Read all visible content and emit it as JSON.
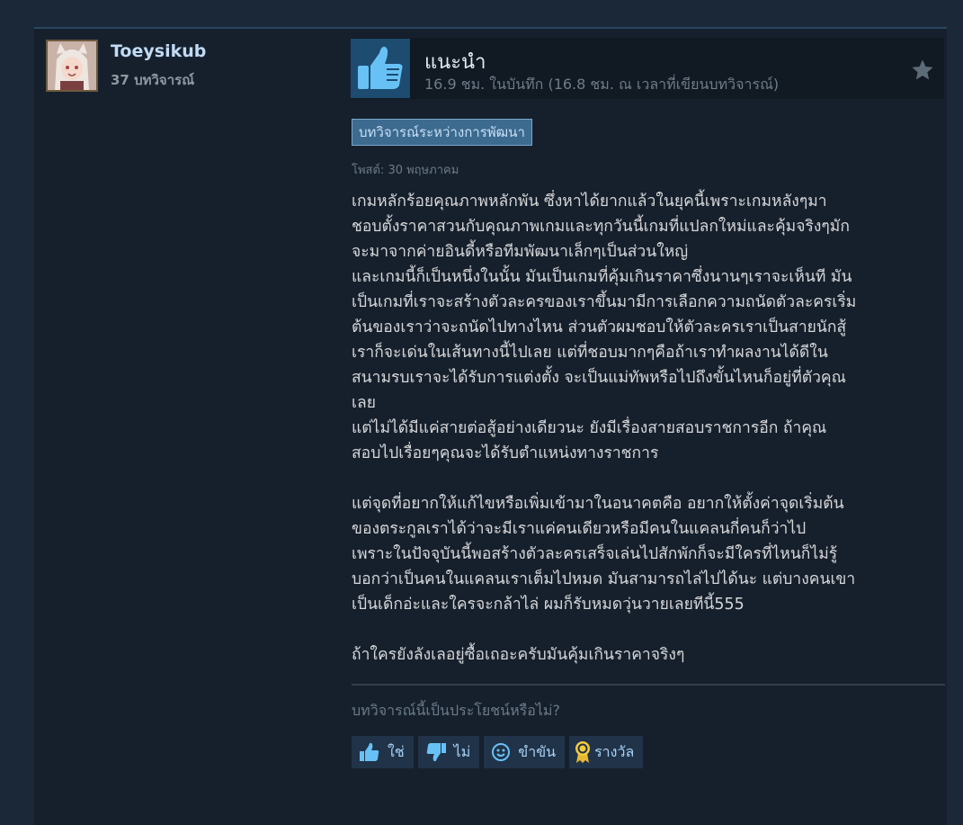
{
  "author": {
    "name": "Toeysikub",
    "review_count": "37 บทวิจารณ์"
  },
  "recommendation": {
    "title": "แนะนำ",
    "hours": "16.9 ชม. ในบันทึก (16.8 ชม. ณ เวลาที่เขียนบทวิจารณ์)",
    "icon": "thumbs-up-icon"
  },
  "badge": "บทวิจารณ์ระหว่างการพัฒนา",
  "posted": "โพสต์: 30 พฤษภาคม",
  "body": {
    "p1": [
      "เกมหลักร้อยคุณภาพหลักพัน ซึ่งหาได้ยากแล้วในยุคนี้เพราะเกมหลังๆมา",
      "ชอบตั้งราคาสวนกับคุณภาพเกมและทุกวันนี้เกมที่แปลกใหม่และคุ้มจริงๆมัก",
      "จะมาจากค่ายอินดี้หรือทีมพัฒนาเล็กๆเป็นส่วนใหญ่",
      "และเกมนี้ก็เป็นหนึ่งในนั้น มันเป็นเกมที่คุ้มเกินราคาซึ่งนานๆเราจะเห็นที มัน",
      "เป็นเกมที่เราจะสร้างตัวละครของเราขึ้นมามีการเลือกความถนัดตัวละครเริ่ม",
      "ต้นของเราว่าจะถนัดไปทางไหน ส่วนตัวผมชอบให้ตัวละครเราเป็นสายนักสู้",
      "เราก็จะเด่นในเส้นทางนี้ไปเลย แต่ที่ชอบมากๆคือถ้าเราทำผลงานได้ดีใน",
      "สนามรบเราจะได้รับการแต่งตั้ง จะเป็นแม่ทัพหรือไปถึงขั้นไหนก็อยู่ที่ตัวคุณ",
      "เลย",
      "แต่ไม่ได้มีแค่สายต่อสู้อย่างเดียวนะ ยังมีเรื่องสายสอบราชการอีก ถ้าคุณ",
      "สอบไปเรื่อยๆคุณจะได้รับตำแหน่งทางราชการ"
    ],
    "p2": [
      "แต่จุดที่อยากให้แก้ไขหรือเพิ่มเข้ามาในอนาคตคือ อยากให้ตั้งค่าจุดเริ่มต้น",
      "ของตระกูลเราได้ว่าจะมีเราแค่คนเดียวหรือมีคนในแคลนกี่คนก็ว่าไป",
      "เพราะในปัจจุบันนี้พอสร้างตัวละครเสร็จเล่นไปสักพักก็จะมีใครที่ไหนก็ไม่รู้",
      "บอกว่าเป็นคนในแคลนเราเต็มไปหมด มันสามารถไล่ไปได้นะ แต่บางคนเขา",
      "เป็นเด็กอ่ะและใครจะกล้าไล่ ผมก็รับหมดวุ่นวายเลยทีนี้555"
    ],
    "p3": [
      "ถ้าใครยังลังเลอยู่ซื้อเถอะครับมันคุ้มเกินราคาจริงๆ"
    ]
  },
  "helpful_question": "บทวิจารณ์นี้เป็นประโยชน์หรือไม่?",
  "votes": {
    "yes": "ใช่",
    "no": "ไม่",
    "funny": "ขำขัน",
    "award": "รางวัล"
  },
  "colors": {
    "background": "#1b2838",
    "card": "#16202d",
    "accent": "#66c0f4",
    "badge": "#3d6a8f"
  }
}
